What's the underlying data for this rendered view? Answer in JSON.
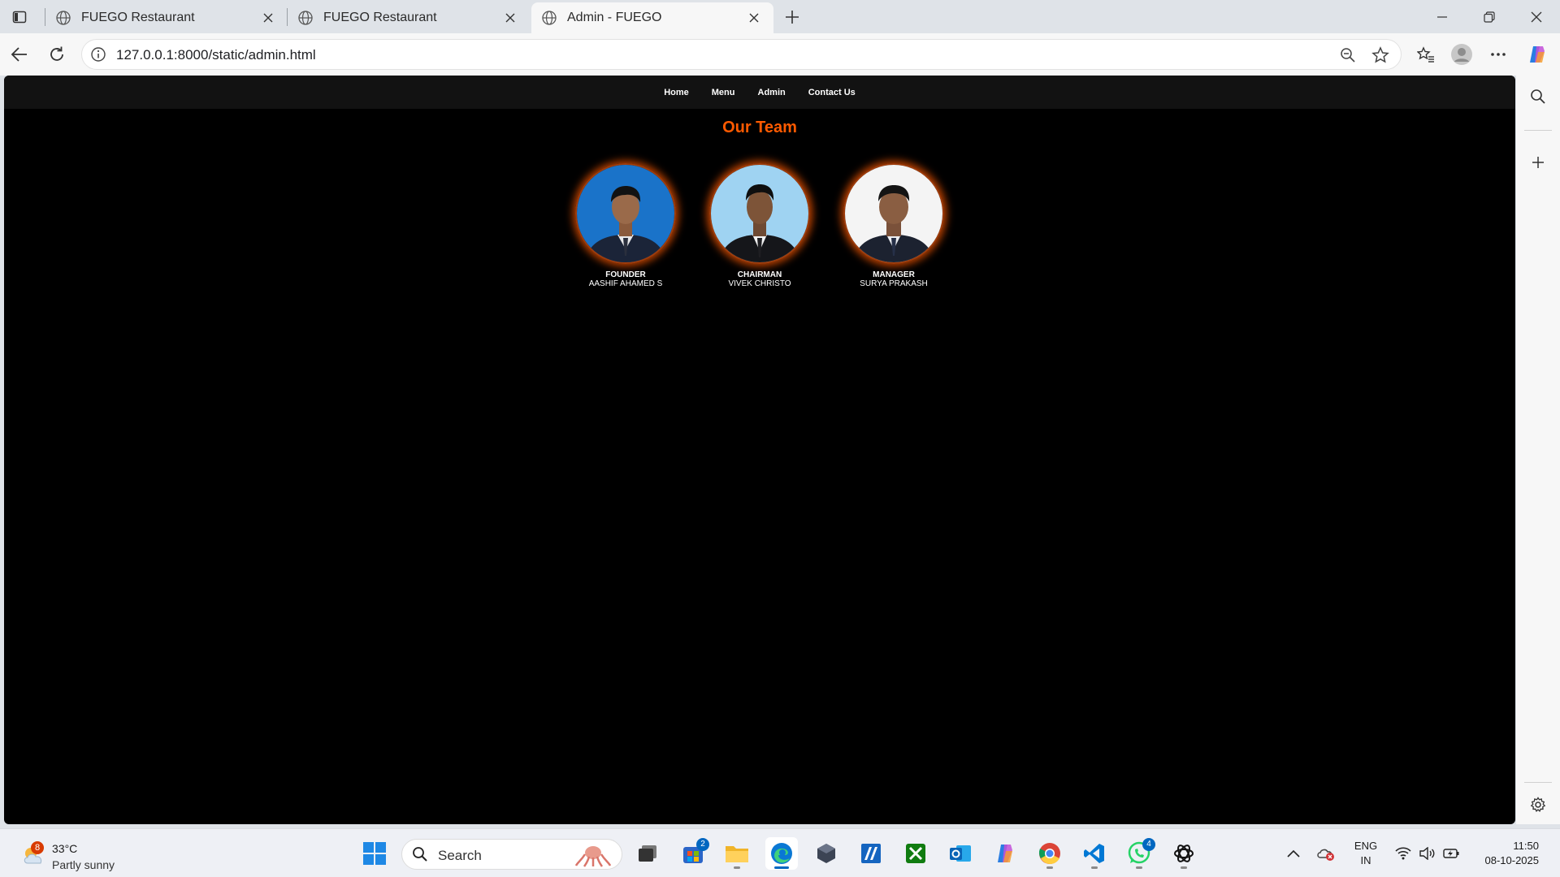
{
  "browser": {
    "tabs": [
      {
        "title": "FUEGO Restaurant"
      },
      {
        "title": "FUEGO Restaurant"
      },
      {
        "title": "Admin - FUEGO"
      }
    ],
    "url": "127.0.0.1:8000/static/admin.html"
  },
  "site": {
    "nav": [
      "Home",
      "Menu",
      "Admin",
      "Contact Us"
    ],
    "team_title": "Our Team",
    "members": [
      {
        "role": "FOUNDER",
        "name": "AASHIF AHAMED S",
        "photo_bg": "#1a73c9"
      },
      {
        "role": "CHAIRMAN",
        "name": "VIVEK CHRISTO",
        "photo_bg": "#9fd3f2"
      },
      {
        "role": "MANAGER",
        "name": "SURYA PRAKASH",
        "photo_bg": "#f4f4f4"
      }
    ],
    "accent_color": "#ff5a00"
  },
  "taskbar": {
    "weather": {
      "temp": "33°C",
      "condition": "Partly sunny",
      "badge": "8"
    },
    "search_placeholder": "Search",
    "badges": {
      "store": "2",
      "whatsapp": "4"
    },
    "lang": {
      "line1": "ENG",
      "line2": "IN"
    },
    "clock": {
      "time": "11:50",
      "date": "08-10-2025"
    }
  }
}
